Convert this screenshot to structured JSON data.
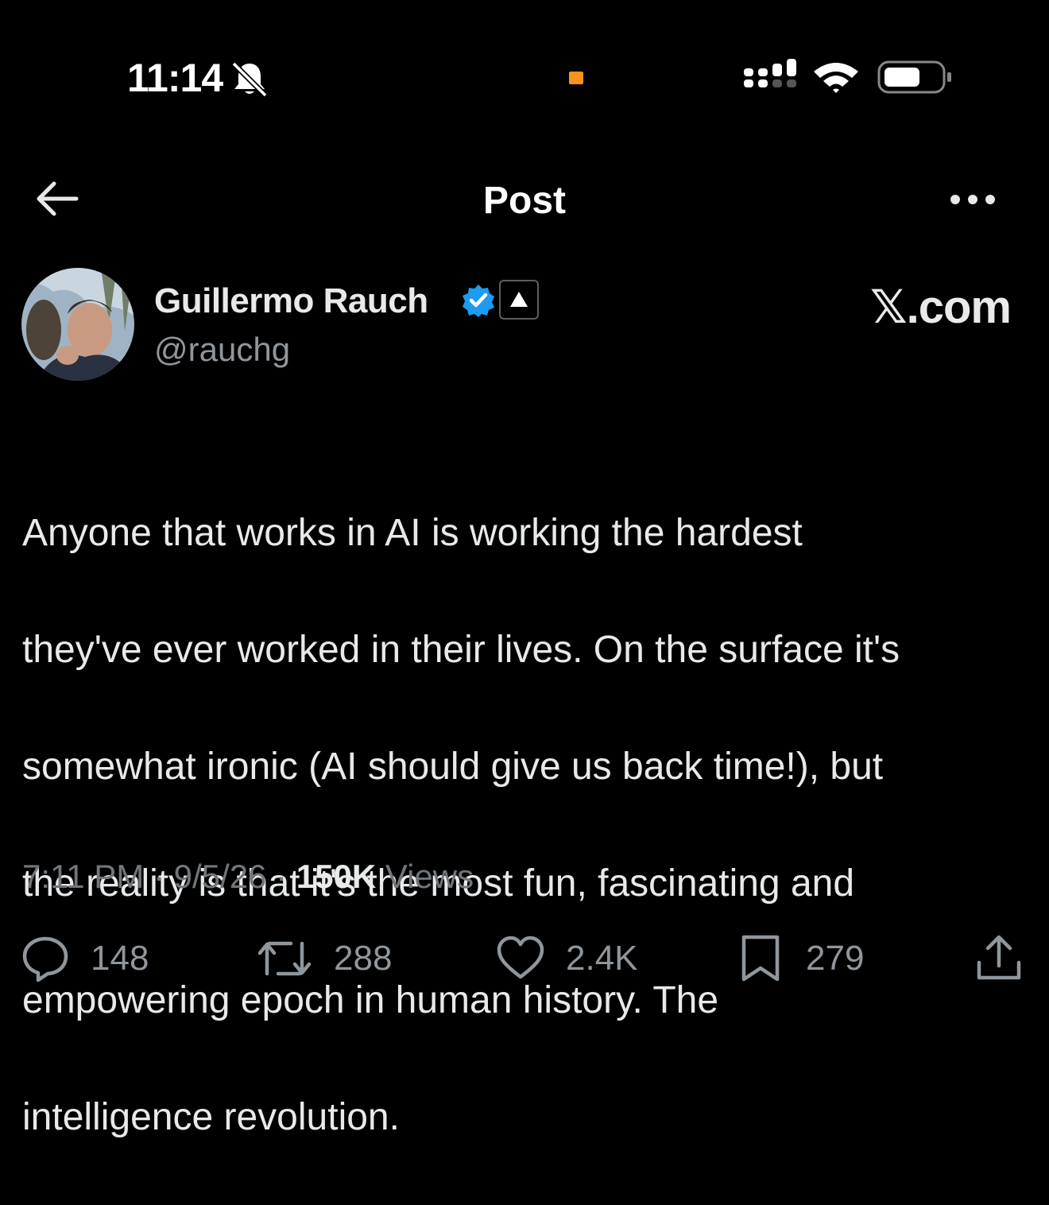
{
  "status_bar": {
    "time": "11:14",
    "icons": [
      "bell-slash-icon",
      "signal-icon",
      "wifi-icon",
      "battery-icon"
    ],
    "privacy_dot_color": "#f7931e"
  },
  "header": {
    "title": "Post",
    "back_icon": "arrow-left-icon",
    "more_icon": "more-dots-icon"
  },
  "author": {
    "name": "Guillermo Rauch",
    "handle": "@rauchg",
    "verified_icon": "verified-badge-icon",
    "verified_color": "#1d9bf0",
    "affiliation_icon": "triangle-logo-icon"
  },
  "watermark": "𝕏.com",
  "tweet": {
    "lines": [
      "Anyone that works in AI is working the hardest",
      "they've ever worked in their lives. On the surface it's",
      "somewhat ironic (AI should give us back time!), but",
      "the reality is that it's the most fun, fascinating and",
      "empowering epoch in human history. The",
      "intelligence revolution."
    ]
  },
  "meta": {
    "time": "7:11 PM",
    "separator": "·",
    "date": "9/5/26",
    "views_count": "150K",
    "views_label": "Views"
  },
  "actions": {
    "reply": {
      "icon": "reply-icon",
      "count": "148"
    },
    "repost": {
      "icon": "repost-icon",
      "count": "288"
    },
    "like": {
      "icon": "heart-icon",
      "count": "2.4K"
    },
    "bookmark": {
      "icon": "bookmark-icon",
      "count": "279"
    },
    "share": {
      "icon": "share-icon"
    }
  },
  "colors": {
    "background": "#000000",
    "text": "#e7e9ea",
    "muted": "#71767b"
  }
}
